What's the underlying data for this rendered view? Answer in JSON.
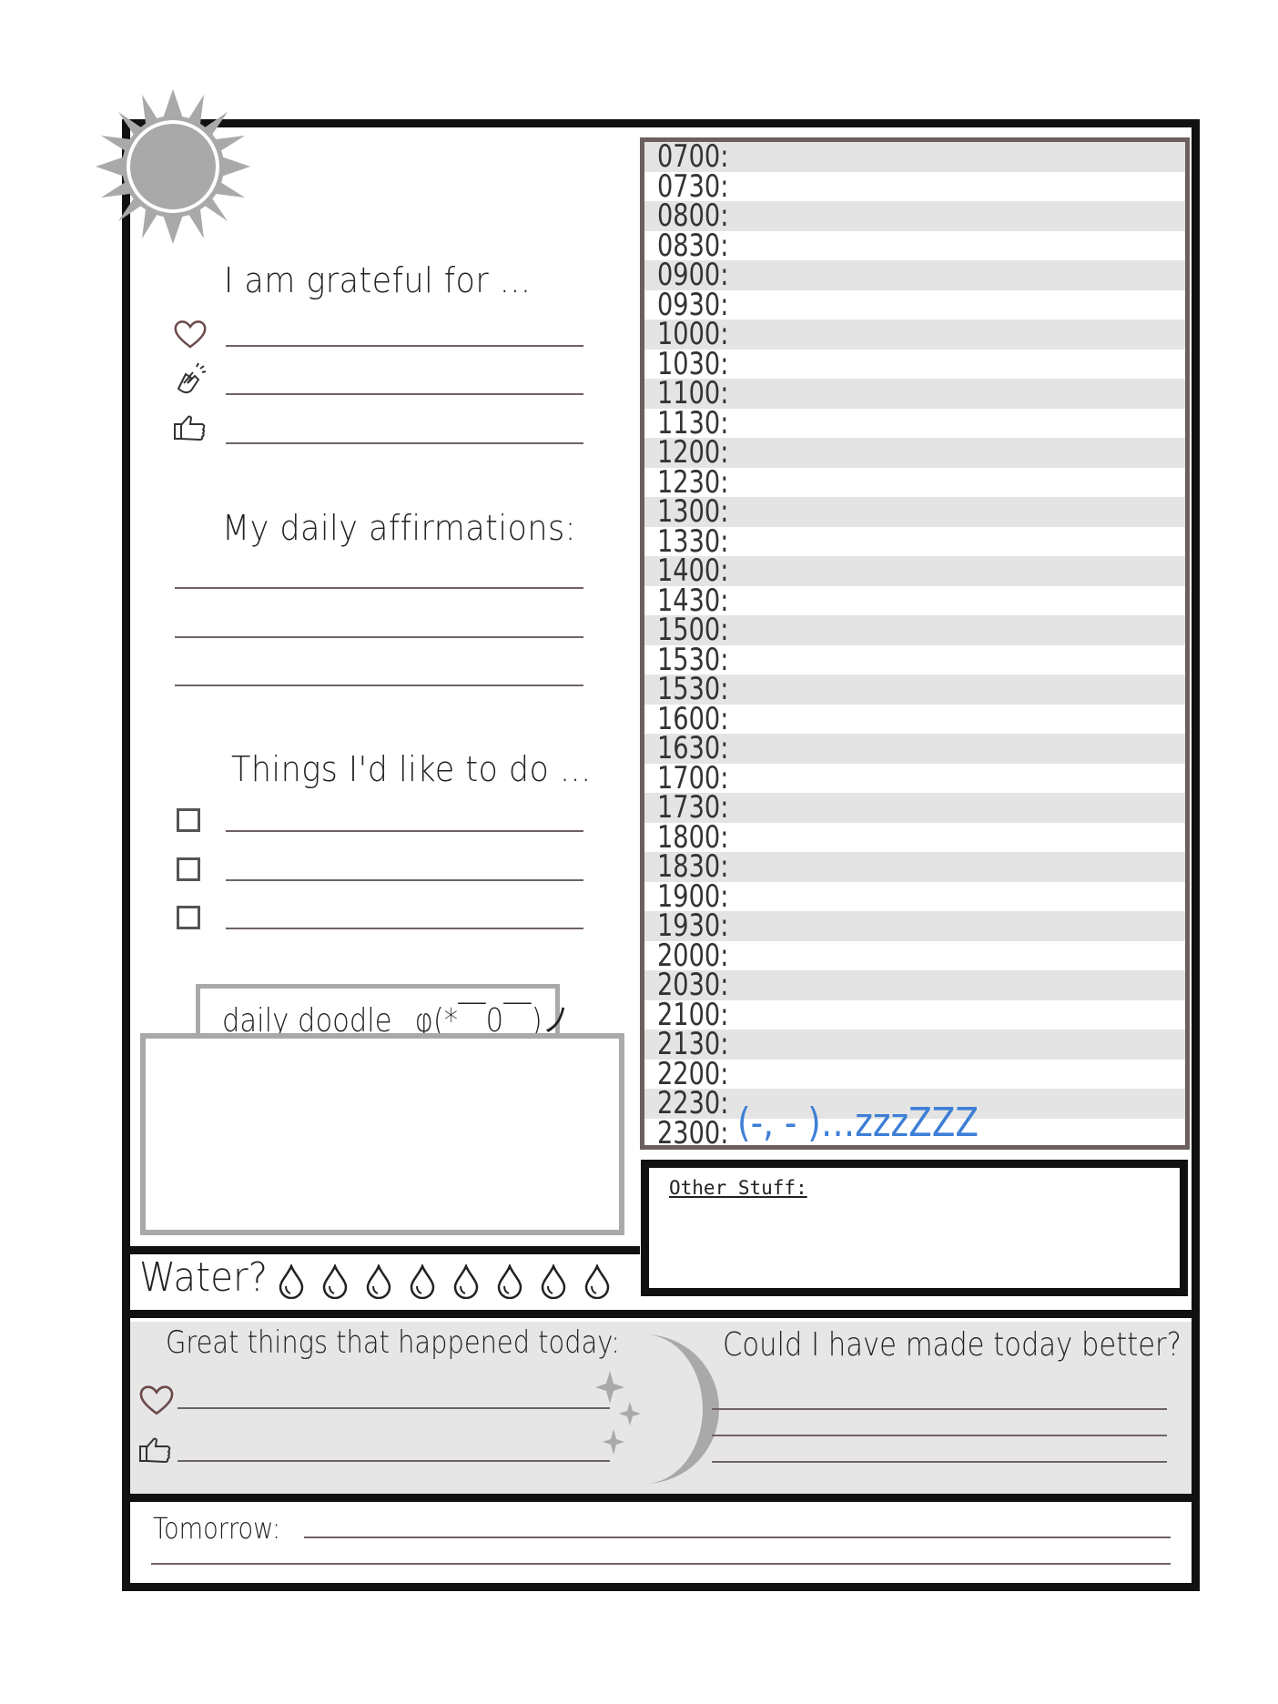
{
  "grateful": {
    "heading": "I am grateful for ...",
    "icons": [
      "heart-icon",
      "clapping-hands-icon",
      "thumbs-up-icon"
    ]
  },
  "affirmations": {
    "heading": "My daily affirmations:"
  },
  "todo": {
    "heading": "Things I'd like to do ..."
  },
  "doodle": {
    "label": "daily doodle _φ(*￣0￣)ノ"
  },
  "water": {
    "label": "Water?",
    "drops": 8
  },
  "schedule": {
    "times": [
      "0700:",
      "0730:",
      "0800:",
      "0830:",
      "0900:",
      "0930:",
      "1000:",
      "1030:",
      "1100:",
      "1130:",
      "1200:",
      "1230:",
      "1300:",
      "1330:",
      "1400:",
      "1430:",
      "1500:",
      "1530:",
      "1530:",
      "1600:",
      "1630:",
      "1700:",
      "1730:",
      "1800:",
      "1830:",
      "1900:",
      "1930:",
      "2000:",
      "2030:",
      "2100:",
      "2130:",
      "2200:",
      "2230:",
      "2300:"
    ],
    "sleep_note": "(-, - )…zzzZZZ"
  },
  "other": {
    "label": "Other Stuff:"
  },
  "evening": {
    "great_heading": "Great things that happened today:",
    "better_heading": "Could I have made today better?"
  },
  "tomorrow": {
    "label": "Tomorrow:"
  },
  "colors": {
    "frame": "#111111",
    "rule": "#6e6363",
    "shade": "#e4e4e4",
    "accent_blue": "#3d7fd6",
    "sun_moon": "#a9a9a9"
  }
}
